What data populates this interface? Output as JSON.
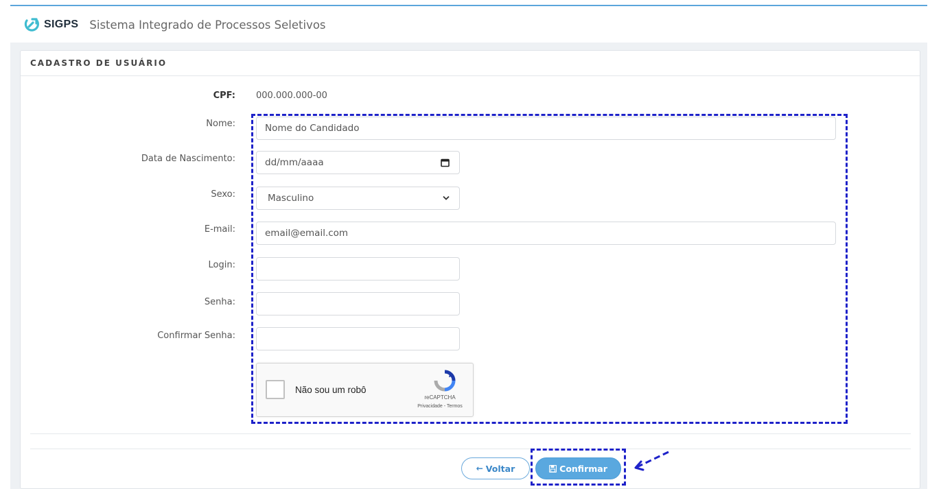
{
  "header": {
    "brand_name": "SIGPS",
    "brand_subtitle": "Sistema Integrado de Processos Seletivos"
  },
  "panel": {
    "title": "CADASTRO DE USUÁRIO"
  },
  "form": {
    "cpf_label": "CPF:",
    "cpf_value": "000.000.000-00",
    "nome_label": "Nome:",
    "nome_value": "Nome do Candidado",
    "nascimento_label": "Data de Nascimento:",
    "nascimento_value": "dd/mm/aaaa",
    "sexo_label": "Sexo:",
    "sexo_value": "Masculino",
    "email_label": "E-mail:",
    "email_value": "email@email.com",
    "login_label": "Login:",
    "login_value": "",
    "senha_label": "Senha:",
    "senha_value": "",
    "confirmar_senha_label": "Confirmar Senha:",
    "confirmar_senha_value": ""
  },
  "captcha": {
    "label": "Não sou um robô",
    "brand": "reCAPTCHA",
    "links": "Privacidade - Termos"
  },
  "actions": {
    "back_label": "Voltar",
    "confirm_label": "Confirmar"
  },
  "colors": {
    "accent": "#5aa8df",
    "annotation": "#1e22c9",
    "topline": "#5ba5db"
  }
}
